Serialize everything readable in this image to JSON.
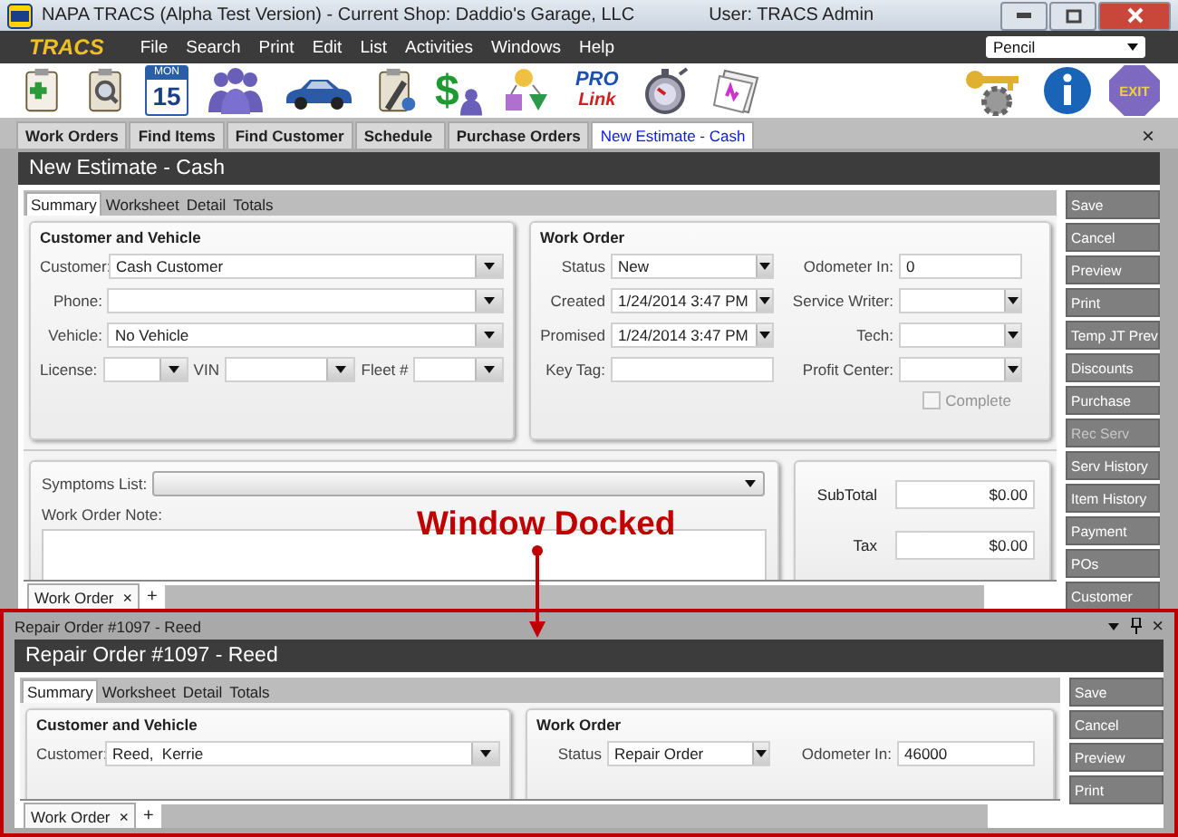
{
  "window": {
    "title": "NAPA TRACS (Alpha Test Version) - Current Shop: Daddio's Garage, LLC",
    "user": "User: TRACS Admin"
  },
  "menu": {
    "logo": "TRACS",
    "items": [
      "File",
      "Search",
      "Print",
      "Edit",
      "List",
      "Activities",
      "Windows",
      "Help"
    ],
    "dropdown": "Pencil"
  },
  "toolbar": {
    "calendar_month": "MON",
    "calendar_day": "15",
    "dollar_sign": "$",
    "prolink_top": "PRO",
    "prolink_bottom": "Link",
    "exit": "EXIT"
  },
  "tabs": [
    {
      "label": "Work Orders",
      "selected": false
    },
    {
      "label": "Find Items",
      "selected": false
    },
    {
      "label": "Find Customer",
      "selected": false
    },
    {
      "label": "Schedule",
      "selected": false
    },
    {
      "label": "Purchase Orders",
      "selected": false
    },
    {
      "label": "New Estimate - Cash",
      "selected": true
    }
  ],
  "tabs_close": "×",
  "document": {
    "title": "New Estimate - Cash",
    "subtabs": [
      {
        "label": "Summary",
        "selected": true
      },
      {
        "label": "Worksheet",
        "selected": false
      },
      {
        "label": "Detail",
        "selected": false
      },
      {
        "label": "Totals",
        "selected": false
      }
    ],
    "customer_vehicle": {
      "title": "Customer and Vehicle",
      "customer_label": "Customer:",
      "customer": "Cash Customer",
      "phone_label": "Phone:",
      "vehicle_label": "Vehicle:",
      "vehicle": "No Vehicle",
      "license_label": "License:",
      "vin_label": "VIN",
      "fleet_label": "Fleet #"
    },
    "work_order": {
      "title": "Work Order",
      "status_label": "Status",
      "status": "New",
      "created_label": "Created",
      "created": "1/24/2014 3:47 PM",
      "promised_label": "Promised",
      "promised": "1/24/2014 3:47 PM",
      "key_tag_label": "Key Tag:",
      "odometer_label": "Odometer In:",
      "odometer": "0",
      "service_writer_label": "Service Writer:",
      "tech_label": "Tech:",
      "profit_center_label": "Profit Center:",
      "complete": {
        "label": "Complete",
        "checked": false,
        "disabled": true
      }
    },
    "symptoms_label": "Symptoms List:",
    "note_label": "Work Order Note:",
    "totals": [
      {
        "label": "SubTotal",
        "value": "$0.00"
      },
      {
        "label": "Tax",
        "value": "$0.00"
      }
    ],
    "actions": [
      {
        "label": "Save",
        "disabled": false
      },
      {
        "label": "Cancel",
        "disabled": false
      },
      {
        "label": "Preview",
        "disabled": false
      },
      {
        "label": "Print",
        "disabled": false
      },
      {
        "label": "Temp JT Prev",
        "disabled": false
      },
      {
        "label": "Discounts",
        "disabled": false
      },
      {
        "label": "Purchase",
        "disabled": false
      },
      {
        "label": "Rec Serv",
        "disabled": true
      },
      {
        "label": "Serv History",
        "disabled": false
      },
      {
        "label": "Item History",
        "disabled": false
      },
      {
        "label": "Payment",
        "disabled": false
      },
      {
        "label": "POs",
        "disabled": false
      },
      {
        "label": "Customer",
        "disabled": false
      }
    ],
    "bottom_tabs": [
      {
        "label": "Work Order",
        "close": "×"
      }
    ],
    "add_tab": "+"
  },
  "annotation": {
    "text": "Window Docked"
  },
  "docked_window": {
    "title": "Repair Order #1097 - Reed",
    "header": "Repair Order #1097 - Reed",
    "close": "×",
    "subtabs": [
      {
        "label": "Summary",
        "selected": true
      },
      {
        "label": "Worksheet",
        "selected": false
      },
      {
        "label": "Detail",
        "selected": false
      },
      {
        "label": "Totals",
        "selected": false
      }
    ],
    "customer_vehicle_title": "Customer and Vehicle",
    "customer_label": "Customer:",
    "customer": "Reed,  Kerrie",
    "work_order_title": "Work Order",
    "status_label": "Status",
    "status": "Repair Order",
    "odometer_label": "Odometer In:",
    "odometer": "46000",
    "actions": [
      {
        "label": "Save",
        "disabled": false
      },
      {
        "label": "Cancel",
        "disabled": false
      },
      {
        "label": "Preview",
        "disabled": false
      },
      {
        "label": "Print",
        "disabled": false
      }
    ],
    "bottom_tabs": [
      {
        "label": "Work Order",
        "close": "×"
      }
    ],
    "add_tab": "+"
  }
}
